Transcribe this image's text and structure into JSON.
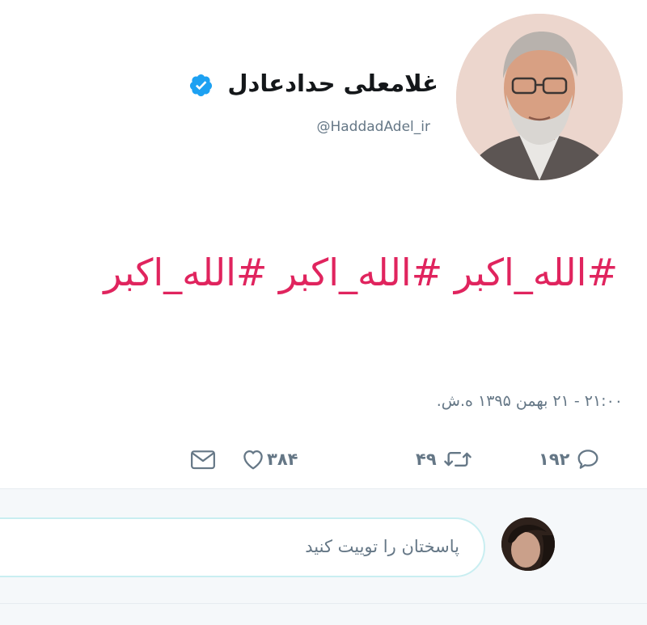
{
  "profile": {
    "display_name": "غلامعلی حدادعادل",
    "handle": "@HaddadAdel_ir",
    "avatar_icon": "profile-photo",
    "verified_icon": "verified-badge-icon"
  },
  "tweet": {
    "text": "#الله_اکبر #الله_اکبر #الله_اکبر",
    "hashtag_color": "#e0245e",
    "timestamp": "۲۱:۰۰ - ۲۱ بهمن ۱۳۹۵ ه.ش."
  },
  "actions": {
    "reply_count": "۱۹۲",
    "retweet_count": "۴۹",
    "like_count": "۳۸۴",
    "icon_color": "#657786"
  },
  "reply_box": {
    "placeholder": "پاسختان را توییت کنید",
    "accent_border": "#c9eef1"
  }
}
